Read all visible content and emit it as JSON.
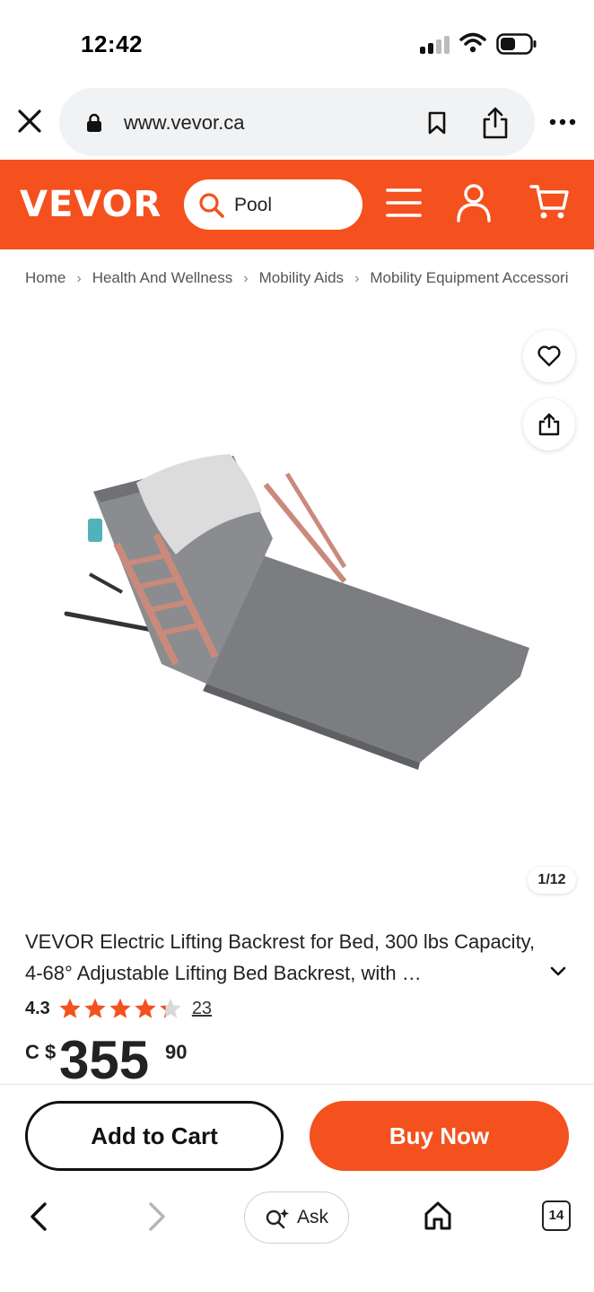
{
  "status": {
    "time": "12:42"
  },
  "browser": {
    "url": "www.vevor.ca"
  },
  "header": {
    "logo": "VEVOR",
    "search_value": "Pool",
    "brand_color": "#f4511e"
  },
  "breadcrumb": [
    "Home",
    "Health And Wellness",
    "Mobility Aids",
    "Mobility Equipment Accessories"
  ],
  "gallery": {
    "counter": "1/12"
  },
  "product": {
    "title": "VEVOR Electric Lifting Backrest for Bed, 300 lbs Capacity, 4-68° Adjustable Lifting Bed Backrest, with …",
    "rating": "4.3",
    "rating_stars": 4.3,
    "review_count": "23",
    "currency": "C $",
    "price_int": "355",
    "price_dec": "90"
  },
  "actions": {
    "add_to_cart": "Add to Cart",
    "buy_now": "Buy Now"
  },
  "toolbar": {
    "ask_label": "Ask",
    "tab_count": "14"
  }
}
